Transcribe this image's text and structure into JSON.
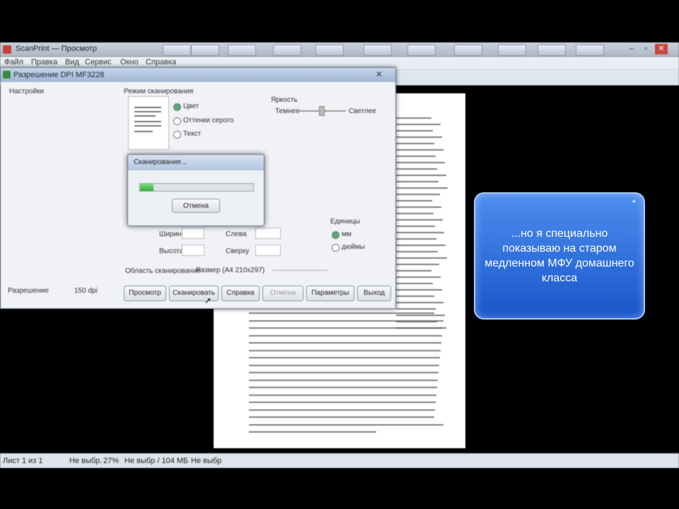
{
  "app": {
    "title": "ScanPrint — Просмотр",
    "taskbar_buttons": 11
  },
  "menu": [
    "Файл",
    "Правка",
    "Вид",
    "Сервис",
    "Окно",
    "Справка"
  ],
  "scan_dialog": {
    "title": "Разрешение DPI MF3228",
    "section_left": "Настройки",
    "section_preview": "Режим сканирования",
    "mode_options": [
      "Цвет",
      "Оттенки серого",
      "Текст"
    ],
    "brightness_label": "Яркость",
    "brightness_low": "Темнее",
    "brightness_high": "Светлее",
    "field_w_label": "Ширина",
    "field_h_label": "Высота",
    "field_x_label": "Слева",
    "field_y_label": "Сверху",
    "units_label": "Единицы",
    "units_options": [
      "мм",
      "дюймы"
    ],
    "area_label": "Область сканирования",
    "paper_label": "Размер (A4 210x297)",
    "resolution_label": "Разрешение",
    "resolution_value": "150 dpi",
    "buttons": [
      "Просмотр",
      "Сканировать",
      "Справка",
      "Отмена",
      "Параметры",
      "Выход"
    ]
  },
  "progress_dialog": {
    "title": "Сканирование...",
    "progress_percent": 12,
    "cancel": "Отмена"
  },
  "status": {
    "pages": "Лист 1 из 1",
    "c1": "Не выбр.",
    "c2": "27%",
    "c3": "Не выбр / 104 МБ",
    "c4": "Не выбр"
  },
  "caption": {
    "text": "...но я специально показываю на старом медленном МФУ домашнего класса"
  },
  "colors": {
    "bubble_top": "#4d8ef0",
    "bubble_bottom": "#1856c9",
    "progress": "#2fae2f"
  }
}
